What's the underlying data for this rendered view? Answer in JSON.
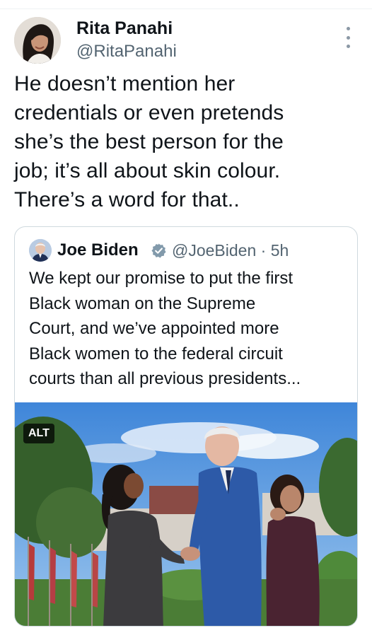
{
  "tweet": {
    "author": {
      "name": "Rita Panahi",
      "handle": "@RitaPanahi"
    },
    "text": "He doesn’t mention her\ncredentials or even pretends\nshe’s the best person for the\njob; it’s all about skin colour.\nThere’s a word for that..",
    "more_icon": "more-vertical-icon"
  },
  "quote": {
    "author": {
      "name": "Joe Biden",
      "verified_icon": "verified-badge-icon",
      "handle_time": "@JoeBiden · 5h"
    },
    "text": "We kept our promise to put the first\nBlack woman on the Supreme\nCourt, and we’ve appointed more\nBlack women to the federal circuit\ncourts than all previous presidents...",
    "media": {
      "alt_label": "ALT"
    }
  },
  "colors": {
    "text": "#0f1419",
    "secondary_text": "#536471",
    "border": "#cfd9de",
    "verified_badge": "#829aab"
  }
}
